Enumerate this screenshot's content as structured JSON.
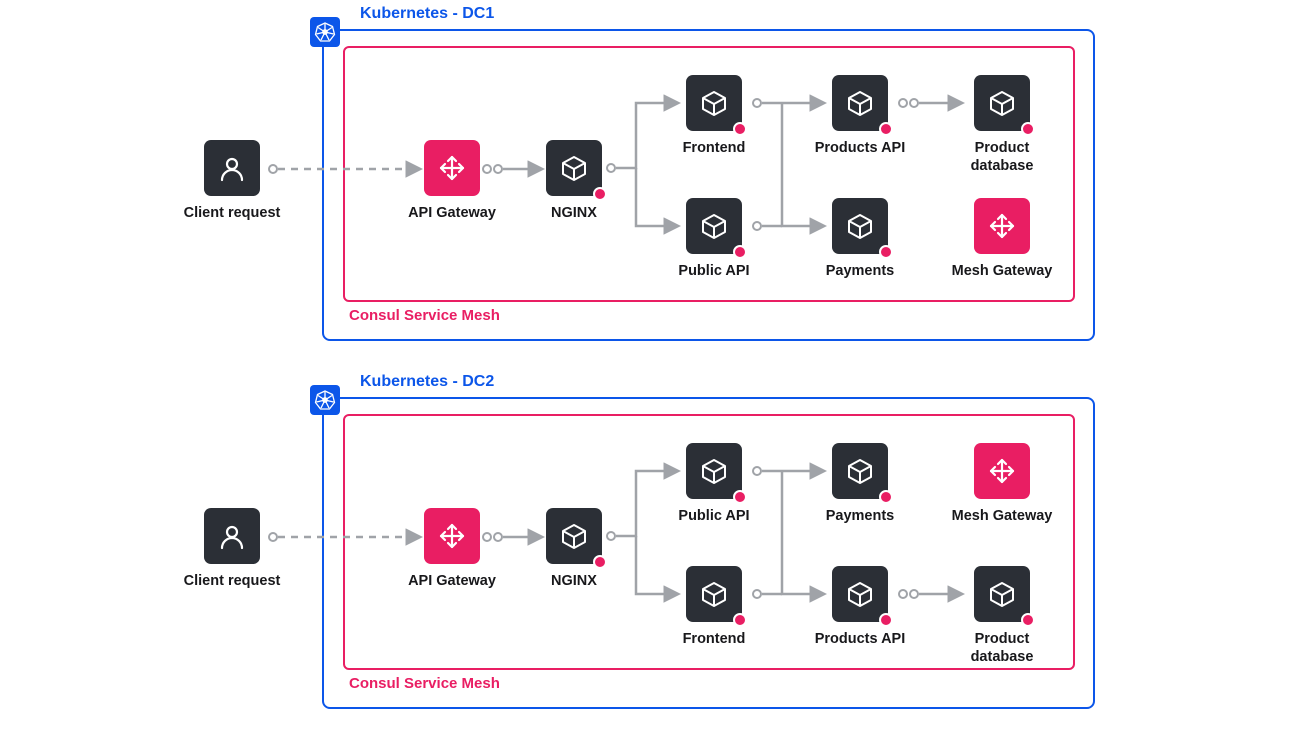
{
  "colors": {
    "cluster_border": "#0c56e9",
    "mesh_border": "#e91e63",
    "node_dark": "#2b2f36",
    "node_pink": "#e91e63",
    "connector": "#a0a3a8"
  },
  "clusters": [
    {
      "title": "Kubernetes - DC1",
      "mesh_title": "Consul Service Mesh"
    },
    {
      "title": "Kubernetes - DC2",
      "mesh_title": "Consul Service Mesh"
    }
  ],
  "nodes": {
    "client": "Client request",
    "api_gateway": "API Gateway",
    "nginx": "NGINX",
    "frontend": "Frontend",
    "public_api": "Public API",
    "products_api": "Products API",
    "payments": "Payments",
    "product_db": "Product database",
    "mesh_gateway": "Mesh Gateway"
  }
}
